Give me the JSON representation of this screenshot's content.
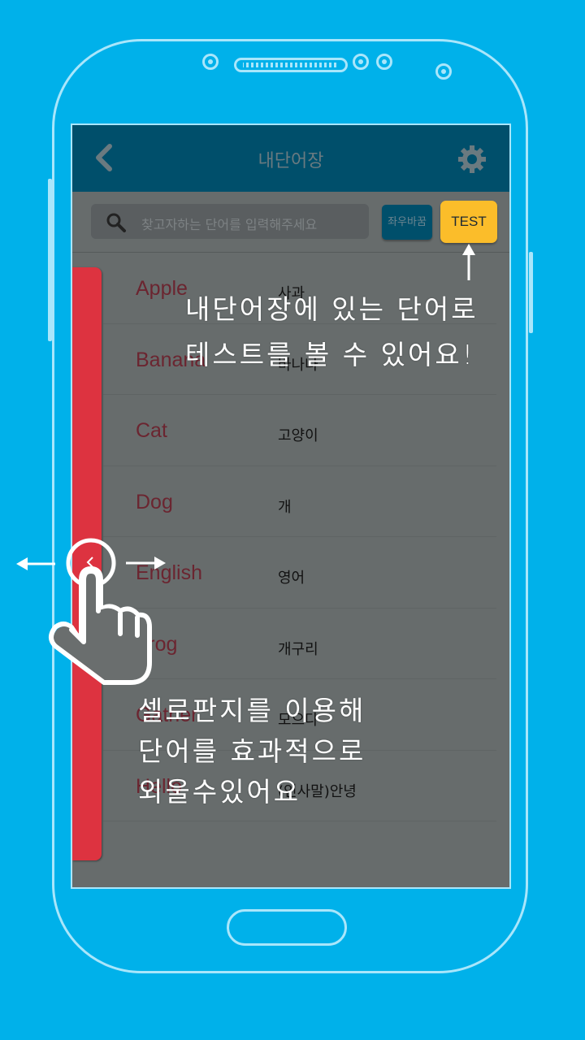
{
  "app": {
    "title": "내단어장",
    "search_placeholder": "찾고자하는 단어를 입력해주세요",
    "swap_button": "좌우바꿈",
    "test_button": "TEST",
    "words": [
      {
        "en": "Apple",
        "ko": "사과"
      },
      {
        "en": "Banana",
        "ko": "바나나"
      },
      {
        "en": "Cat",
        "ko": "고양이"
      },
      {
        "en": "Dog",
        "ko": "개"
      },
      {
        "en": "English",
        "ko": "영어"
      },
      {
        "en": "Frog",
        "ko": "개구리"
      },
      {
        "en": "Gather",
        "ko": "모으다"
      },
      {
        "en": "Hello",
        "ko": "(인사말)안녕"
      }
    ]
  },
  "annotations": {
    "test_note_line1": "내단어장에 있는 단어로",
    "test_note_line2": "테스트를 볼 수 있어요!",
    "cello_note_line1": "셀로판지를 이용해",
    "cello_note_line2": "단어를 효과적으로",
    "cello_note_line3": "외울수있어요"
  },
  "colors": {
    "background": "#00b1ea",
    "header": "#004f6b",
    "test_button": "#fbbd2a",
    "cellophane": "#dd3340",
    "word_en": "#6b2530"
  },
  "icons": [
    "back-chevron-icon",
    "gear-icon",
    "search-icon",
    "swipe-hand-icon"
  ]
}
